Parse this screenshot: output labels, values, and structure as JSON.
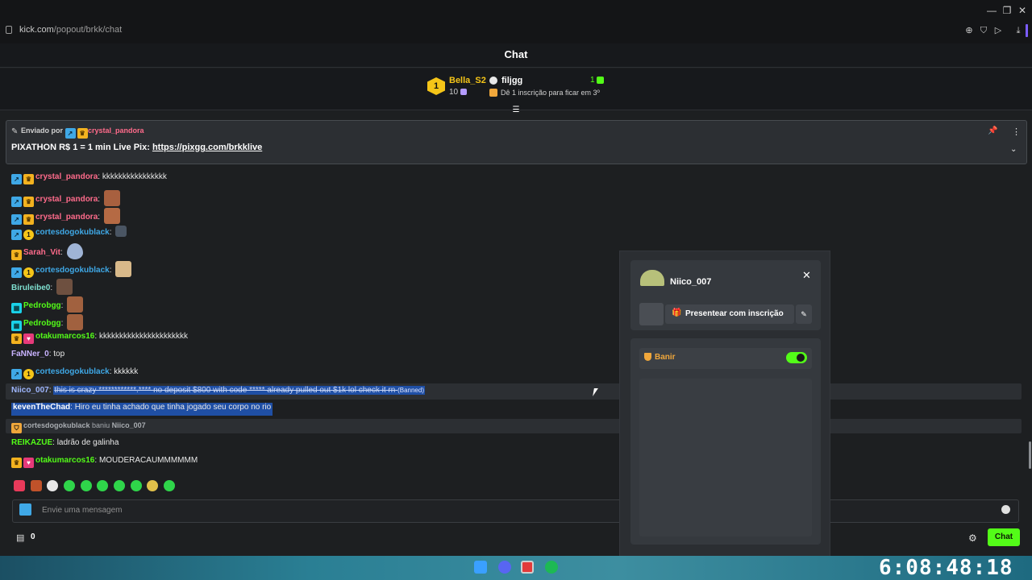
{
  "browser": {
    "url_host": "kick.com",
    "url_path": "/popout/brkk/chat",
    "min": "—",
    "max": "❐",
    "close": "✕"
  },
  "chat_title": "Chat",
  "leaderboard": {
    "first": {
      "rank": "1",
      "name": "Bella_S2",
      "count": "10"
    },
    "second": {
      "name": "filjgg",
      "count": "1"
    },
    "subline": "Dê 1 inscrição para ficar em 3º"
  },
  "pinned": {
    "sent_by": "Enviado por",
    "user": "crystal_pandora",
    "message": "PIXATHON R$ 1 = 1 min Live Pix: ",
    "link": "https://pixgg.com/brkklive"
  },
  "messages": [
    {
      "user": "crystal_pandora",
      "color": "#ff6b8b",
      "text": "kkkkkkkkkkkkkkkk"
    },
    {
      "user": "crystal_pandora",
      "color": "#ff6b8b",
      "text": ""
    },
    {
      "user": "crystal_pandora",
      "color": "#ff6b8b",
      "text": ""
    },
    {
      "user": "cortesdogokublack",
      "color": "#3fa8e6",
      "text": ""
    },
    {
      "user": "Sarah_Vit",
      "color": "#ff6b8b",
      "text": ""
    },
    {
      "user": "cortesdogokublack",
      "color": "#3fa8e6",
      "text": ""
    },
    {
      "user": "Biruleibe0",
      "color": "#7fe0d0",
      "text": ""
    },
    {
      "user": "Pedrobgg",
      "color": "#53fc18",
      "text": ""
    },
    {
      "user": "Pedrobgg",
      "color": "#53fc18",
      "text": ""
    },
    {
      "user": "otakumarcos16",
      "color": "#53fc18",
      "text": "kkkkkkkkkkkkkkkkkkkkkk"
    },
    {
      "user": "FaNNer_0",
      "color": "#c9b3ff",
      "text": "top"
    },
    {
      "user": "cortesdogokublack",
      "color": "#3fa8e6",
      "text": "kkkkkk"
    },
    {
      "user": "Niico_007",
      "color": "#9fb7ff",
      "text": "this is crazy ************.**** no deposit $800 with code ***** already pulled out $1k lol check it rn",
      "tag": "(Banned)"
    },
    {
      "user": "kevenTheChad",
      "color": "#ffffff",
      "text": "Hiro eu tinha achado que tinha jogado seu corpo no rio"
    },
    {
      "user": "REIKAZUE",
      "color": "#53fc18",
      "text": "ladrão de galinha"
    },
    {
      "user": "otakumarcos16",
      "color": "#53fc18",
      "text": "MOUDERACAUMMMMMM"
    }
  ],
  "ban_event": {
    "mod": "cortesdogokublack",
    "action": "baniu",
    "target": "Niico_007"
  },
  "input": {
    "placeholder": "Envie uma mensagem"
  },
  "footer": {
    "store_count": "0",
    "chat_button": "Chat"
  },
  "popup": {
    "username": "Niico_007",
    "gift_label": "Presentear com inscrição",
    "ban_label": "Banir",
    "ban_enabled": true
  },
  "clock": "6:08:48:18",
  "colors": {
    "accent": "#53fc18",
    "banned_select": "#1f4fa5"
  }
}
